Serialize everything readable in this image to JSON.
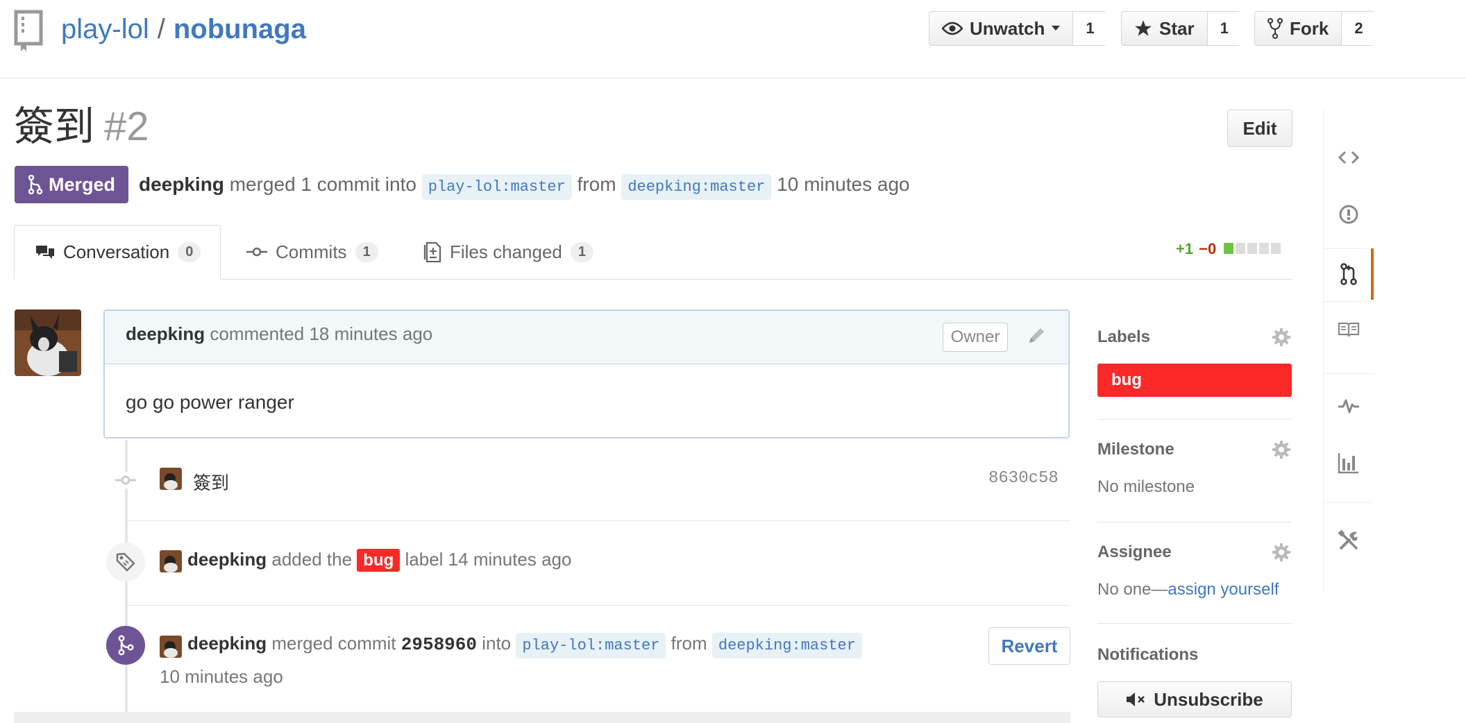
{
  "repo": {
    "owner": "play-lol",
    "separator": "/",
    "name": "nobunaga"
  },
  "header_buttons": {
    "watch": {
      "label": "Unwatch",
      "count": "1"
    },
    "star": {
      "label": "Star",
      "count": "1"
    },
    "fork": {
      "label": "Fork",
      "count": "2"
    }
  },
  "pr": {
    "title": "簽到",
    "number": "#2",
    "edit_label": "Edit",
    "state": "Merged",
    "author": "deepking",
    "merged_text": "merged 1 commit into",
    "base_owner": "play-lol",
    "base_branch": "master",
    "from_text": "from",
    "head_owner": "deepking",
    "head_branch": "master",
    "time": "10 minutes ago"
  },
  "tabs": [
    {
      "label": "Conversation",
      "count": "0"
    },
    {
      "label": "Commits",
      "count": "1"
    },
    {
      "label": "Files changed",
      "count": "1"
    }
  ],
  "diffstat": {
    "additions": "+1",
    "deletions": "−0",
    "blocks_added": 1,
    "blocks_total": 5
  },
  "comment": {
    "author": "deepking",
    "action": "commented",
    "time": "18 minutes ago",
    "role": "Owner",
    "body": "go go power ranger"
  },
  "timeline": {
    "commit": {
      "message": "簽到",
      "sha": "8630c58"
    },
    "label_event": {
      "actor": "deepking",
      "text_before": "added the",
      "label": "bug",
      "text_after": "label",
      "time": "14 minutes ago"
    },
    "merge_event": {
      "actor": "deepking",
      "text": "merged commit",
      "commit": "2958960",
      "into_text": "into",
      "base_owner": "play-lol",
      "base_branch": "master",
      "from_text": "from",
      "head_owner": "deepking",
      "head_branch": "master",
      "time": "10 minutes ago",
      "revert_label": "Revert"
    }
  },
  "sidebar": {
    "labels": {
      "title": "Labels",
      "items": [
        "bug"
      ],
      "color": "#fc2929"
    },
    "milestone": {
      "title": "Milestone",
      "value": "No milestone"
    },
    "assignee": {
      "title": "Assignee",
      "value": "No one—",
      "link": "assign yourself"
    },
    "notifications": {
      "title": "Notifications",
      "button": "Unsubscribe"
    }
  },
  "colors": {
    "merged": "#6e5494",
    "link": "#4078c0",
    "label_bug": "#fc2929",
    "active_nav": "#d26911"
  },
  "icons": [
    "repo-icon",
    "eye-icon",
    "star-icon",
    "fork-icon",
    "merge-icon",
    "comment-icon",
    "commit-icon",
    "file-diff-icon",
    "pencil-icon",
    "tag-icon",
    "gear-icon",
    "mute-icon",
    "code-icon",
    "issue-icon",
    "pull-request-icon",
    "book-icon",
    "pulse-icon",
    "graph-icon",
    "tools-icon"
  ]
}
